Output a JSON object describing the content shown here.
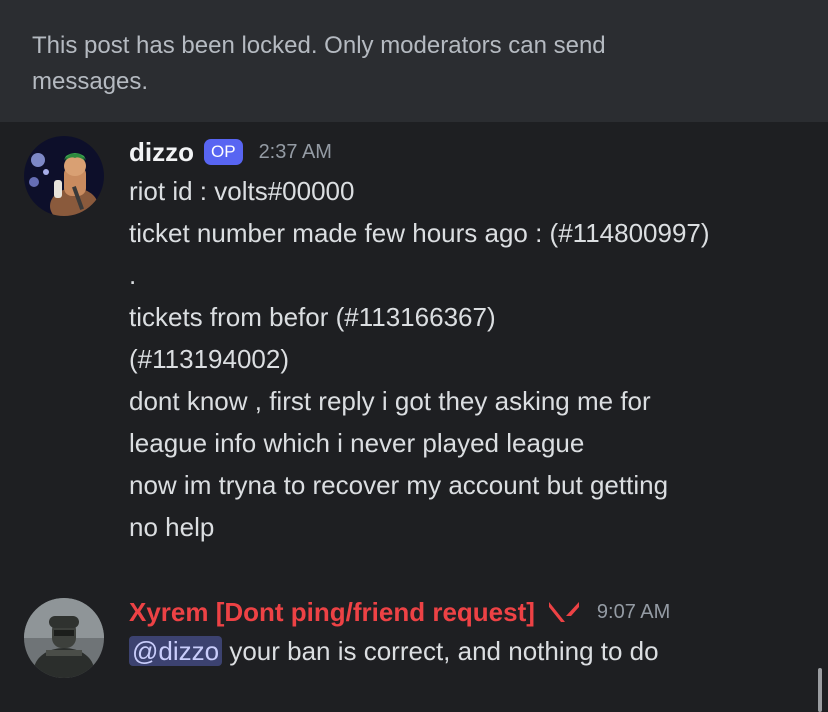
{
  "banner": {
    "text": "This post has been locked. Only moderators can send messages."
  },
  "messages": [
    {
      "author": "dizzo",
      "badge": "OP",
      "time": "2:37 AM",
      "lines": [
        "riot id : volts#00000",
        "ticket number made few hours ago : (#114800997)",
        ".",
        "tickets from befor (#113166367)",
        "(#113194002)",
        "dont know , first reply i got they asking me for",
        "league info which i never played league",
        "now im tryna to recover my account but getting",
        "no help"
      ],
      "avatar_icon": "anime-swordsman-avatar"
    },
    {
      "author": "Xyrem [Dont ping/friend request]",
      "role_icon": "valorant-logo-icon",
      "time": "9:07 AM",
      "mention": "@dizzo",
      "text_after_mention": " your ban is correct, and nothing to do",
      "avatar_icon": "soldier-avatar"
    }
  ],
  "colors": {
    "background": "#1e1f22",
    "banner": "#2b2d31",
    "op_badge": "#5865f2",
    "role_red": "#ed4245",
    "mention_bg": "#3c4270"
  }
}
